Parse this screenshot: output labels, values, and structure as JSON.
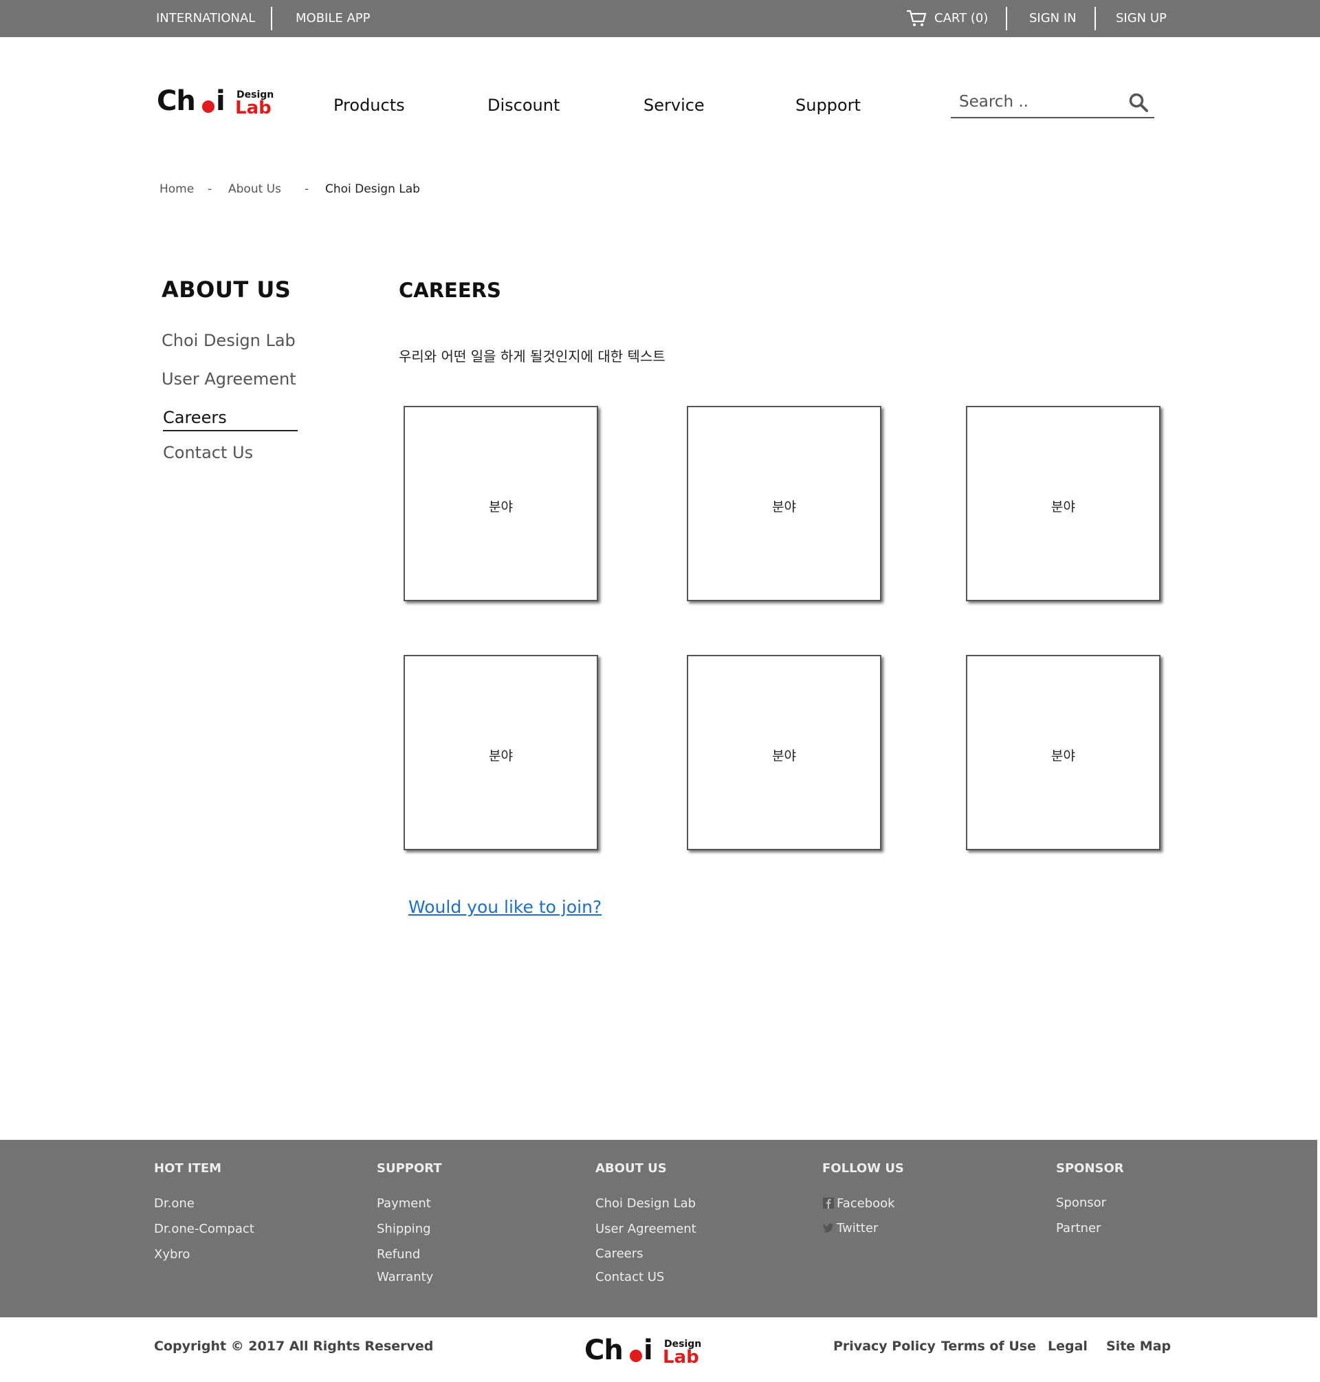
{
  "topbar": {
    "international": "INTERNATIONAL",
    "mobile_app": "MOBILE APP",
    "cart": "CART (0)",
    "sign_in": "SIGN IN",
    "sign_up": "SIGN UP"
  },
  "logo": {
    "ch": "Ch",
    "i": "i",
    "design": "Design",
    "lab": "Lab"
  },
  "nav": {
    "products": "Products",
    "discount": "Discount",
    "service": "Service",
    "support": "Support"
  },
  "search": {
    "placeholder": "Search .."
  },
  "breadcrumb": {
    "home": "Home",
    "about": "About Us",
    "current": "Choi Design Lab",
    "separator": "-"
  },
  "sidebar": {
    "title": "ABOUT US",
    "items": [
      {
        "label": "Choi Design Lab"
      },
      {
        "label": "User Agreement"
      },
      {
        "label": "Careers"
      },
      {
        "label": "Contact Us"
      }
    ]
  },
  "main": {
    "title": "CAREERS",
    "intro": "우리와 어떤 일을 하게 될것인지에 대한 텍스트",
    "cards": [
      {
        "label": "분야"
      },
      {
        "label": "분야"
      },
      {
        "label": "분야"
      },
      {
        "label": "분야"
      },
      {
        "label": "분야"
      },
      {
        "label": "분야"
      }
    ],
    "join": "Would you like to join?"
  },
  "footer": {
    "hot_item": {
      "title": "HOT ITEM",
      "links": [
        "Dr.one",
        "Dr.one-Compact",
        "Xybro"
      ]
    },
    "support": {
      "title": "SUPPORT",
      "links": [
        "Payment",
        "Shipping",
        "Refund",
        "Warranty"
      ]
    },
    "about": {
      "title": "ABOUT US",
      "links": [
        "Choi Design Lab",
        "User Agreement",
        "Careers",
        "Contact US"
      ]
    },
    "follow": {
      "title": "FOLLOW US",
      "links": [
        "Facebook",
        "Twitter"
      ]
    },
    "sponsor": {
      "title": "SPONSOR",
      "links": [
        "Sponsor",
        "Partner"
      ]
    }
  },
  "bottom": {
    "copyright": "Copyright © 2017 All Rights Reserved",
    "privacy": "Privacy Policy",
    "terms": "Terms of Use",
    "legal": "Legal",
    "sitemap": "Site Map"
  },
  "colors": {
    "bar": "#737373",
    "accent": "#e21a1a",
    "link": "#1a6ed8"
  }
}
